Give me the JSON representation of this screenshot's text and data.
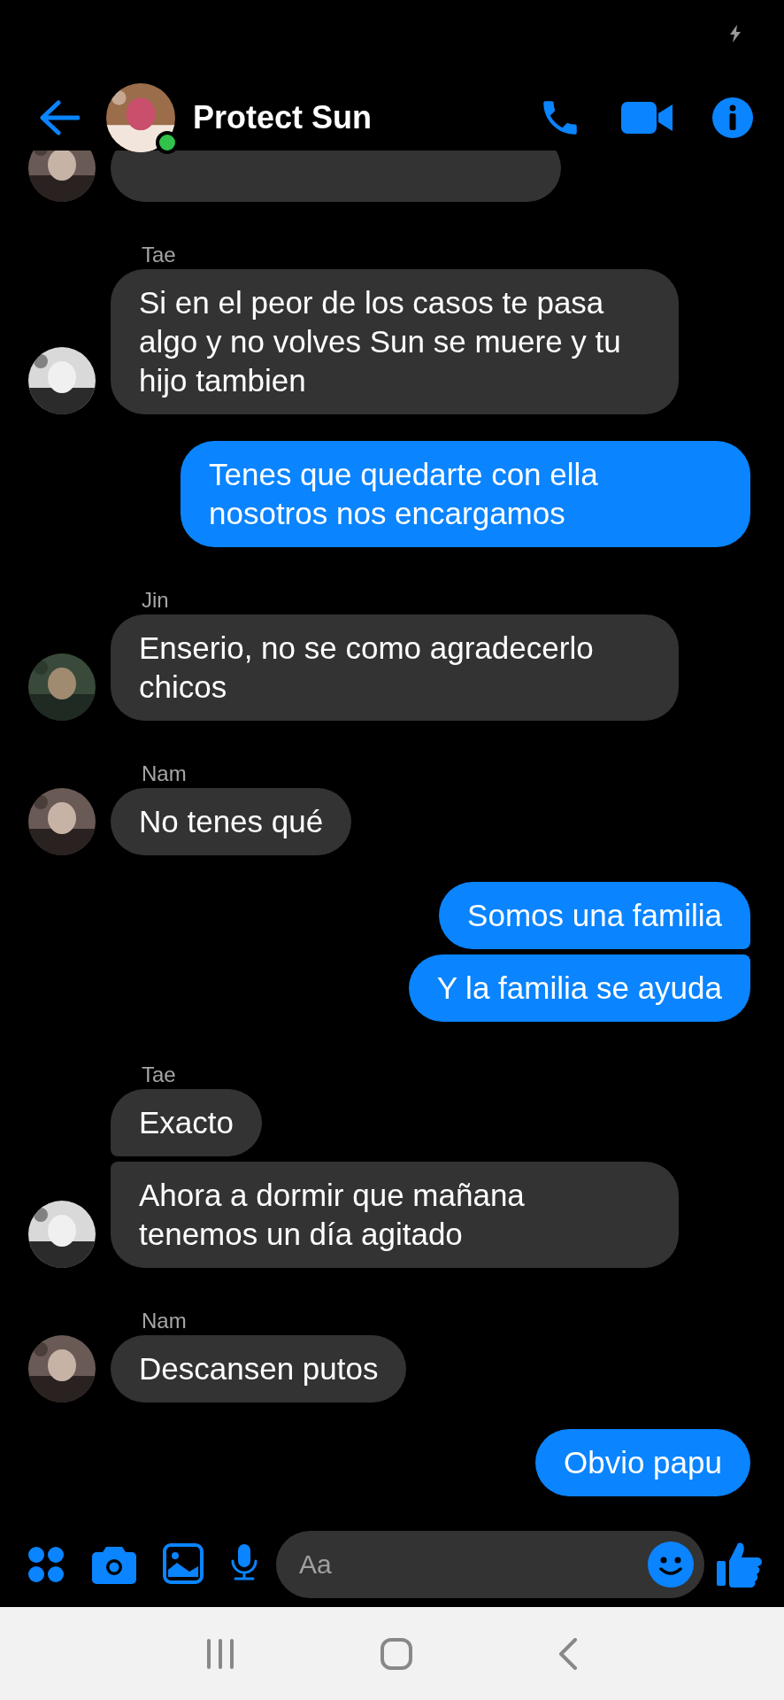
{
  "header": {
    "title": "Protect Sun",
    "online": true
  },
  "partial_message": {
    "kind": "incoming"
  },
  "groups": [
    {
      "kind": "incoming",
      "sender": "Tae",
      "messages": [
        "Si en el peor de los casos te pasa algo y no volves Sun se muere y tu hijo tambien"
      ]
    },
    {
      "kind": "outgoing",
      "messages": [
        "Tenes que quedarte con ella nosotros nos encargamos"
      ]
    },
    {
      "kind": "incoming",
      "sender": "Jin",
      "messages": [
        "Enserio, no se como agradecerlo chicos"
      ]
    },
    {
      "kind": "incoming",
      "sender": "Nam",
      "messages": [
        "No tenes qué"
      ]
    },
    {
      "kind": "outgoing",
      "messages": [
        "Somos una familia",
        "Y la familia se ayuda"
      ]
    },
    {
      "kind": "incoming",
      "sender": "Tae",
      "messages": [
        "Exacto",
        "Ahora a dormir que mañana tenemos un día agitado"
      ]
    },
    {
      "kind": "incoming",
      "sender": "Nam",
      "messages": [
        "Descansen putos"
      ]
    },
    {
      "kind": "outgoing",
      "messages": [
        "Obvio papu"
      ]
    }
  ],
  "composer": {
    "placeholder": "Aa"
  }
}
